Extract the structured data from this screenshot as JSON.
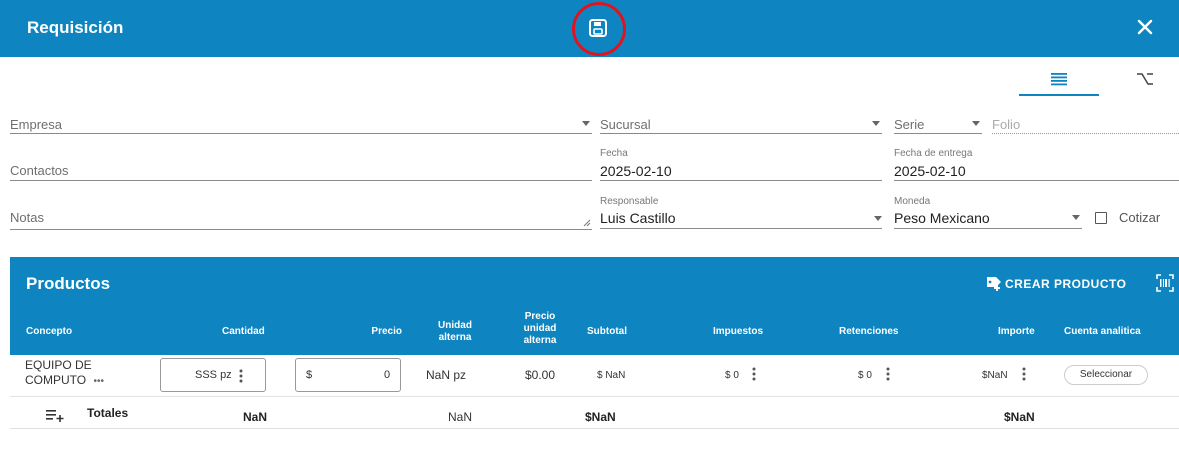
{
  "header": {
    "title": "Requisición",
    "save_icon": "save-icon",
    "close_icon": "close-icon"
  },
  "view_toggles": {
    "list_icon": "list-icon",
    "alt_icon": "option-key-icon"
  },
  "form": {
    "empresa": {
      "placeholder": "Empresa",
      "value": ""
    },
    "sucursal": {
      "placeholder": "Sucursal",
      "value": ""
    },
    "serie": {
      "placeholder": "Serie",
      "value": ""
    },
    "folio": {
      "placeholder": "Folio",
      "value": ""
    },
    "contactos": {
      "placeholder": "Contactos",
      "value": ""
    },
    "fecha": {
      "label": "Fecha",
      "value": "2025-02-10"
    },
    "fecha_entrega": {
      "label": "Fecha de entrega",
      "value": "2025-02-10"
    },
    "notas": {
      "placeholder": "Notas",
      "value": ""
    },
    "responsable": {
      "label": "Responsable",
      "value": "Luis Castillo"
    },
    "moneda": {
      "label": "Moneda",
      "value": "Peso Mexicano"
    },
    "cotizar": {
      "label": "Cotizar",
      "checked": false
    }
  },
  "products": {
    "title": "Productos",
    "crear_label": "CREAR PRODUCTO",
    "columns": {
      "concepto": "Concepto",
      "cantidad": "Cantidad",
      "precio": "Precio",
      "unidad_alterna_1": "Unidad",
      "unidad_alterna_2": "alterna",
      "precio_unidad_1": "Precio",
      "precio_unidad_2": "unidad",
      "precio_unidad_3": "alterna",
      "subtotal": "Subtotal",
      "impuestos": "Impuestos",
      "retenciones": "Retenciones",
      "importe": "Importe",
      "cuenta_analitica": "Cuenta analitica"
    },
    "rows": [
      {
        "concepto_1": "EQUIPO DE",
        "concepto_2": "COMPUTO",
        "more": "•••",
        "cantidad": "SSS pz",
        "precio_currency": "$",
        "precio": "0",
        "unidad_alterna": "NaN pz",
        "precio_unidad_alterna": "$0.00",
        "subtotal": "$ NaN",
        "impuestos": "$ 0",
        "retenciones": "$ 0",
        "importe": "$NaN",
        "cuenta_analitica": "Seleccionar"
      }
    ],
    "totals": {
      "label": "Totales",
      "cantidad": "NaN",
      "unidad_alterna": "NaN",
      "subtotal": "$NaN",
      "importe": "$NaN"
    }
  },
  "colors": {
    "primary": "#0e85c0",
    "highlight": "#e0141e"
  }
}
